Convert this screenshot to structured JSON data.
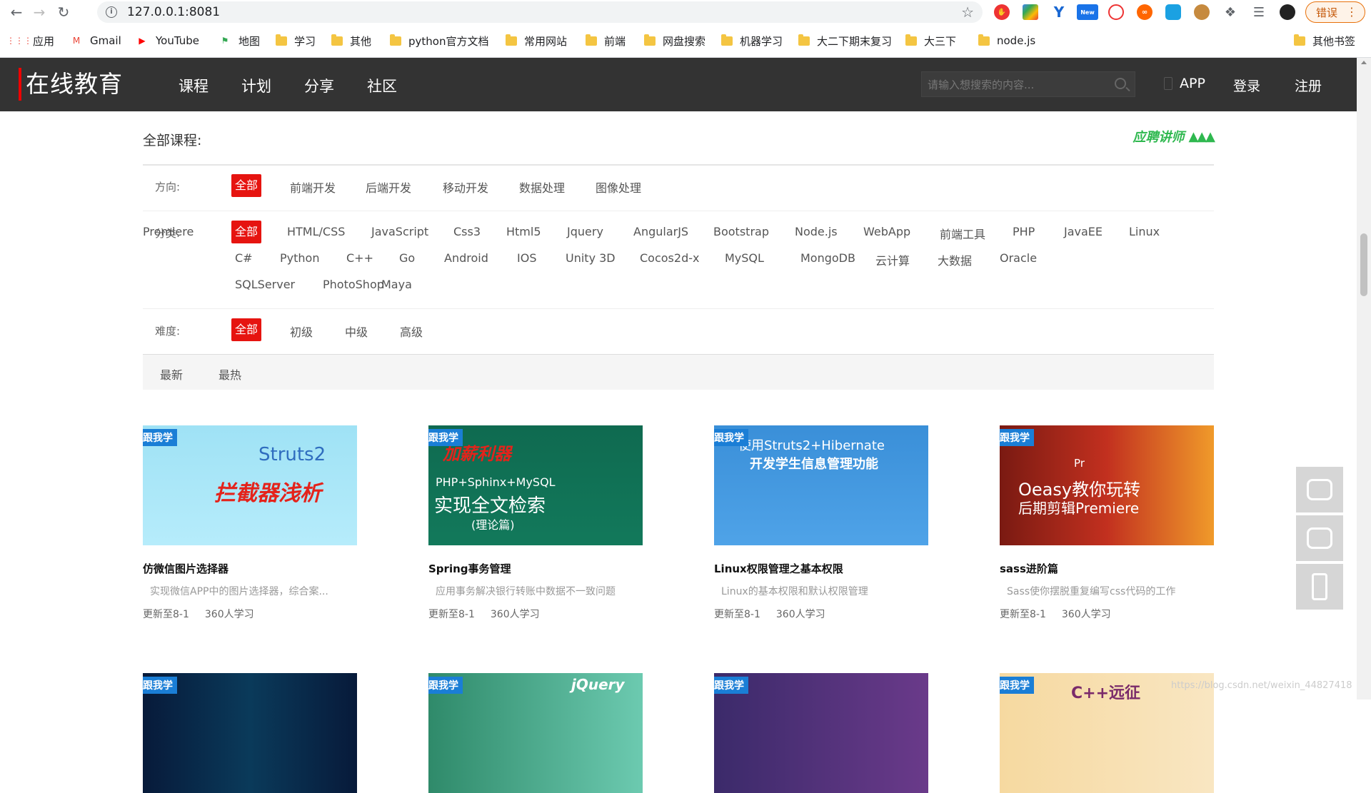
{
  "browser": {
    "url": "127.0.0.1:8081",
    "profile_label": "错误",
    "bookmarks": [
      {
        "label": "应用",
        "icon": "apps-grid-icon"
      },
      {
        "label": "Gmail",
        "icon": "gmail-icon"
      },
      {
        "label": "YouTube",
        "icon": "youtube-icon"
      },
      {
        "label": "地图",
        "icon": "maps-icon"
      },
      {
        "label": "学习",
        "icon": "folder-icon"
      },
      {
        "label": "其他",
        "icon": "folder-icon"
      },
      {
        "label": "python官方文档",
        "icon": "folder-icon"
      },
      {
        "label": "常用网站",
        "icon": "folder-icon"
      },
      {
        "label": "前端",
        "icon": "folder-icon"
      },
      {
        "label": "网盘搜索",
        "icon": "folder-icon"
      },
      {
        "label": "机器学习",
        "icon": "folder-icon"
      },
      {
        "label": "大二下期末复习",
        "icon": "folder-icon"
      },
      {
        "label": "大三下",
        "icon": "folder-icon"
      },
      {
        "label": "node.js",
        "icon": "folder-icon"
      },
      {
        "label": "其他书签",
        "icon": "folder-icon"
      }
    ]
  },
  "header": {
    "logo": "在线教育",
    "nav": [
      "课程",
      "计划",
      "分享",
      "社区"
    ],
    "search_placeholder": "请输入想搜索的内容...",
    "app": "APP",
    "login": "登录",
    "register": "注册"
  },
  "filters": {
    "title": "全部课程:",
    "recruit": "应聘讲师",
    "direction": {
      "label": "方向:",
      "items": [
        "全部",
        "前端开发",
        "后端开发",
        "移动开发",
        "数据处理",
        "图像处理"
      ]
    },
    "category": {
      "label": "分类:",
      "items": [
        "全部",
        "HTML/CSS",
        "JavaScript",
        "Css3",
        "Html5",
        "Jquery",
        "AngularJS",
        "Bootstrap",
        "Node.js",
        "WebApp",
        "前端工具",
        "PHP",
        "JavaEE",
        "Linux",
        "C#",
        "Python",
        "C++",
        "Go",
        "Android",
        "IOS",
        "Unity 3D",
        "Cocos2d-x",
        "MySQL",
        "MongoDB",
        "云计算",
        "大数据",
        "Oracle",
        "SQLServer",
        "PhotoShop",
        "Maya",
        "Promiere"
      ]
    },
    "difficulty": {
      "label": "难度:",
      "items": [
        "全部",
        "初级",
        "中级",
        "高级"
      ]
    },
    "sort": [
      "最新",
      "最热"
    ]
  },
  "courses": [
    {
      "badge": "跟我学",
      "title": "仿微信图片选择器",
      "desc": "实现微信APP中的图片选择器，综合案...",
      "update": "更新至8-1",
      "learners": "360人学习",
      "thumb_lines": [
        "Struts2",
        "拦截器浅析"
      ]
    },
    {
      "badge": "跟我学",
      "title": "Spring事务管理",
      "desc": "应用事务解决银行转账中数据不一致问题",
      "update": "更新至8-1",
      "learners": "360人学习",
      "thumb_lines": [
        "加薪利器",
        "PHP+Sphinx+MySQL",
        "实现全文检索",
        "(理论篇)"
      ]
    },
    {
      "badge": "跟我学",
      "title": "Linux权限管理之基本权限",
      "desc": "Linux的基本权限和默认权限管理",
      "update": "更新至8-1",
      "learners": "360人学习",
      "thumb_lines": [
        "使用Struts2+Hibernate",
        "开发学生信息管理功能"
      ]
    },
    {
      "badge": "跟我学",
      "title": "sass进阶篇",
      "desc": "Sass使你摆脱重复编写css代码的工作",
      "update": "更新至8-1",
      "learners": "360人学习",
      "thumb_lines": [
        "Pr",
        "Oeasy教你玩转",
        "后期剪辑Premiere"
      ]
    },
    {
      "badge": "跟我学",
      "title": "",
      "desc": "",
      "update": "",
      "learners": "",
      "thumb_lines": []
    },
    {
      "badge": "跟我学",
      "title": "",
      "desc": "",
      "update": "",
      "learners": "",
      "thumb_lines": [
        "jQuery"
      ]
    },
    {
      "badge": "跟我学",
      "title": "",
      "desc": "",
      "update": "",
      "learners": "",
      "thumb_lines": []
    },
    {
      "badge": "跟我学",
      "title": "",
      "desc": "",
      "update": "",
      "learners": "",
      "thumb_lines": [
        "C++远征"
      ]
    }
  ],
  "watermark": "https://blog.csdn.net/weixin_44827418",
  "colors": {
    "accent": "#e61410",
    "header_bg": "#333333",
    "badge": "#1a7ed6",
    "recruit": "#2fb84f"
  }
}
